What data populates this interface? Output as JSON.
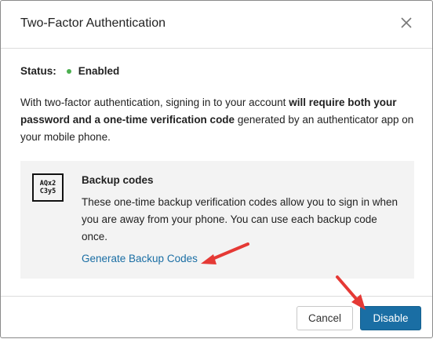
{
  "dialog": {
    "title": "Two-Factor Authentication",
    "status": {
      "label": "Status:",
      "value": "Enabled",
      "color": "#4caf50"
    },
    "description": {
      "part1": "With two-factor authentication, signing in to your account ",
      "bold": "will require both your password and a one-time verification code",
      "part2": " generated by an authenticator app on your mobile phone."
    },
    "backup": {
      "icon_line1": "AQx2",
      "icon_line2": "C3y5",
      "title": "Backup codes",
      "description": "These one-time backup verification codes allow you to sign in when you are away from your phone. You can use each backup code once.",
      "link": "Generate Backup Codes"
    },
    "buttons": {
      "cancel": "Cancel",
      "disable": "Disable"
    }
  },
  "colors": {
    "accent": "#1a6ea4",
    "annotation_arrow": "#e53935"
  },
  "icons": {
    "close": "close-icon",
    "backup": "backup-codes-icon"
  }
}
